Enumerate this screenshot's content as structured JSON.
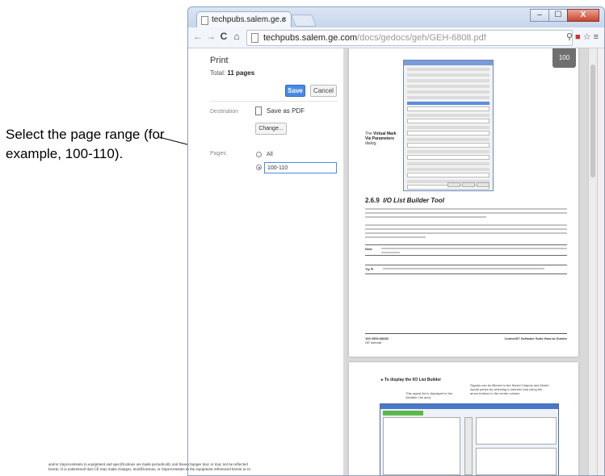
{
  "callout": {
    "text": "Select the page range (for example, 100-110)."
  },
  "browser": {
    "tab_title": "techpubs.salem.ge.c",
    "tab_close": "×",
    "url_host": "techpubs.salem.ge.com",
    "url_path": "/docs/gedocs/geh/GEH-6808.pdf",
    "window_buttons": [
      "–",
      "☐",
      "X"
    ]
  },
  "print_panel": {
    "title": "Print",
    "total_label": "Total:",
    "total_value": "11 pages",
    "save_label": "Save",
    "cancel_label": "Cancel",
    "destination_label": "Destination",
    "destination_value": "Save as PDF",
    "change_label": "Change...",
    "pages_label": "Pages",
    "all_label": "All",
    "range_value": "100-110"
  },
  "preview": {
    "zoom_badge": "100",
    "page1": {
      "caption_prefix": "The",
      "caption_bold": "Virtual Mark Vie Parameters",
      "caption_suffix": "dialog.",
      "heading_num": "2.6.9",
      "heading_text": "I/O List Builder Tool",
      "note_label": "Note",
      "tip_label": "Tip ✎",
      "footer_left": "100   GEH-6808C",
      "footer_left2": "GE Internal",
      "footer_right": "ControlST Software Suite How-to Guides"
    },
    "page2": {
      "heading": "▸  To display the I/O List Builder",
      "cap_left": "This signal list is displayed in the Variable List area.",
      "cap_right": "Signals can be filtered to the Model Outputs and Model Inputs panes by selecting a member and using the arrow buttons in the center column."
    },
    "bottom_text_1": "and/or improvements in equipment and specifications are made periodically and these changes may or may not be reflected",
    "bottom_text_2": "herein. It is understood that GE may make changes, modifications, or improvements to the equipment referenced herein or to"
  }
}
